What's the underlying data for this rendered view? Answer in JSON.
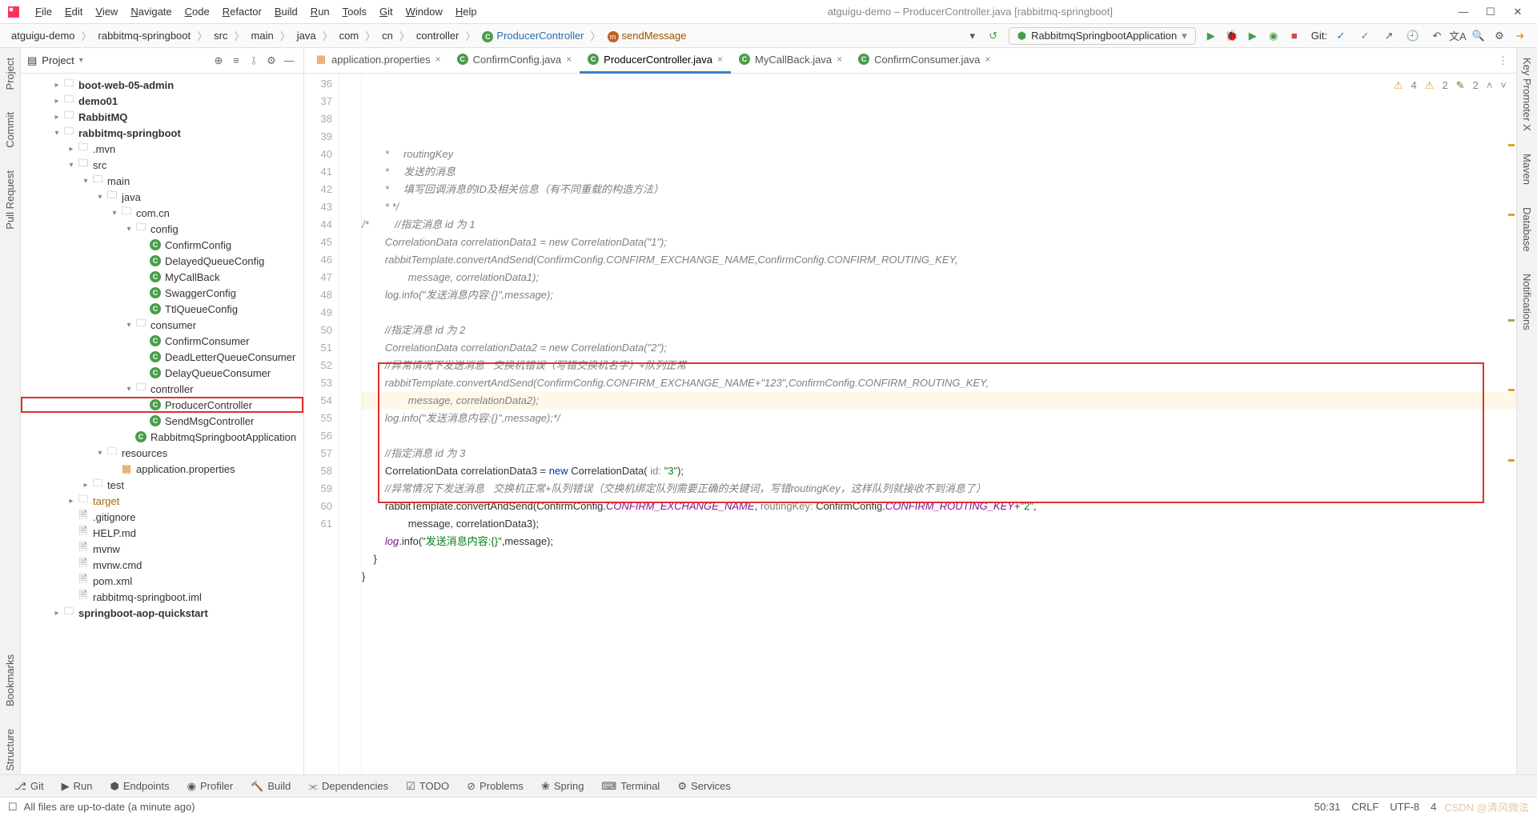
{
  "window": {
    "title": "atguigu-demo – ProducerController.java [rabbitmq-springboot]"
  },
  "menu": [
    "File",
    "Edit",
    "View",
    "Navigate",
    "Code",
    "Refactor",
    "Build",
    "Run",
    "Tools",
    "Git",
    "Window",
    "Help"
  ],
  "breadcrumbs": [
    {
      "label": "atguigu-demo",
      "kind": "plain"
    },
    {
      "label": "rabbitmq-springboot",
      "kind": "plain"
    },
    {
      "label": "src",
      "kind": "plain"
    },
    {
      "label": "main",
      "kind": "plain"
    },
    {
      "label": "java",
      "kind": "plain"
    },
    {
      "label": "com",
      "kind": "plain"
    },
    {
      "label": "cn",
      "kind": "plain"
    },
    {
      "label": "controller",
      "kind": "plain"
    },
    {
      "label": "ProducerController",
      "kind": "class"
    },
    {
      "label": "sendMessage",
      "kind": "method"
    }
  ],
  "runConfig": "RabbitmqSpringbootApplication",
  "gitLabel": "Git:",
  "projectPanel": {
    "title": "Project"
  },
  "tree": [
    {
      "indent": 1,
      "arrow": "▸",
      "icon": "folder",
      "label": "boot-web-05-admin",
      "bold": true
    },
    {
      "indent": 1,
      "arrow": "▸",
      "icon": "folder",
      "label": "demo01",
      "bold": true
    },
    {
      "indent": 1,
      "arrow": "▸",
      "icon": "folder",
      "label": "RabbitMQ",
      "bold": true
    },
    {
      "indent": 1,
      "arrow": "▾",
      "icon": "folder",
      "label": "rabbitmq-springboot",
      "bold": true
    },
    {
      "indent": 2,
      "arrow": "▸",
      "icon": "folder",
      "label": ".mvn"
    },
    {
      "indent": 2,
      "arrow": "▾",
      "icon": "folder-blue",
      "label": "src"
    },
    {
      "indent": 3,
      "arrow": "▾",
      "icon": "folder-blue",
      "label": "main"
    },
    {
      "indent": 4,
      "arrow": "▾",
      "icon": "folder-blue",
      "label": "java"
    },
    {
      "indent": 5,
      "arrow": "▾",
      "icon": "folder",
      "label": "com.cn"
    },
    {
      "indent": 6,
      "arrow": "▾",
      "icon": "folder",
      "label": "config"
    },
    {
      "indent": 7,
      "arrow": "",
      "icon": "class",
      "label": "ConfirmConfig"
    },
    {
      "indent": 7,
      "arrow": "",
      "icon": "class",
      "label": "DelayedQueueConfig"
    },
    {
      "indent": 7,
      "arrow": "",
      "icon": "class",
      "label": "MyCallBack"
    },
    {
      "indent": 7,
      "arrow": "",
      "icon": "class",
      "label": "SwaggerConfig"
    },
    {
      "indent": 7,
      "arrow": "",
      "icon": "class",
      "label": "TtlQueueConfig"
    },
    {
      "indent": 6,
      "arrow": "▾",
      "icon": "folder",
      "label": "consumer"
    },
    {
      "indent": 7,
      "arrow": "",
      "icon": "class",
      "label": "ConfirmConsumer"
    },
    {
      "indent": 7,
      "arrow": "",
      "icon": "class",
      "label": "DeadLetterQueueConsumer"
    },
    {
      "indent": 7,
      "arrow": "",
      "icon": "class",
      "label": "DelayQueueConsumer"
    },
    {
      "indent": 6,
      "arrow": "▾",
      "icon": "folder",
      "label": "controller"
    },
    {
      "indent": 7,
      "arrow": "",
      "icon": "class",
      "label": "ProducerController",
      "selected": true
    },
    {
      "indent": 7,
      "arrow": "",
      "icon": "class",
      "label": "SendMsgController"
    },
    {
      "indent": 6,
      "arrow": "",
      "icon": "class",
      "label": "RabbitmqSpringbootApplication"
    },
    {
      "indent": 4,
      "arrow": "▾",
      "icon": "folder-orange",
      "label": "resources"
    },
    {
      "indent": 5,
      "arrow": "",
      "icon": "prop",
      "label": "application.properties"
    },
    {
      "indent": 3,
      "arrow": "▸",
      "icon": "folder",
      "label": "test"
    },
    {
      "indent": 2,
      "arrow": "▸",
      "icon": "folder-orange",
      "label": "target",
      "orange": true
    },
    {
      "indent": 2,
      "arrow": "",
      "icon": "file",
      "label": ".gitignore"
    },
    {
      "indent": 2,
      "arrow": "",
      "icon": "file",
      "label": "HELP.md"
    },
    {
      "indent": 2,
      "arrow": "",
      "icon": "file",
      "label": "mvnw"
    },
    {
      "indent": 2,
      "arrow": "",
      "icon": "file",
      "label": "mvnw.cmd"
    },
    {
      "indent": 2,
      "arrow": "",
      "icon": "file",
      "label": "pom.xml"
    },
    {
      "indent": 2,
      "arrow": "",
      "icon": "file",
      "label": "rabbitmq-springboot.iml"
    },
    {
      "indent": 1,
      "arrow": "▸",
      "icon": "folder",
      "label": "springboot-aop-quickstart",
      "bold": true
    }
  ],
  "tabs": [
    {
      "icon": "prop",
      "label": "application.properties",
      "active": false
    },
    {
      "icon": "class",
      "label": "ConfirmConfig.java",
      "active": false
    },
    {
      "icon": "class",
      "label": "ProducerController.java",
      "active": true
    },
    {
      "icon": "class",
      "label": "MyCallBack.java",
      "active": false
    },
    {
      "icon": "class",
      "label": "ConfirmConsumer.java",
      "active": false
    }
  ],
  "inspection": {
    "warn1": "4",
    "warn2": "2",
    "up": "2"
  },
  "gutter": {
    "start": 36,
    "end": 61
  },
  "code": [
    {
      "n": 36,
      "html": "        <span class='cm-comment'>*     routingKey</span>"
    },
    {
      "n": 37,
      "html": "        <span class='cm-comment'>*     发送的消息</span>"
    },
    {
      "n": 38,
      "html": "        <span class='cm-comment'>*     填写回调消息的ID及相关信息（有不同重载的构造方法）</span>"
    },
    {
      "n": 39,
      "html": "        <span class='cm-comment'>* */</span>"
    },
    {
      "n": 40,
      "html": "<span class='cm-comment'>/*</span>         <span class='cm-comment'>//指定消息 id 为 1</span>"
    },
    {
      "n": 41,
      "html": "        <span class='cm-comment'>CorrelationData correlationData1 = new CorrelationData(\"1\");</span>"
    },
    {
      "n": 42,
      "html": "        <span class='cm-comment'>rabbitTemplate.convertAndSend(ConfirmConfig.CONFIRM_EXCHANGE_NAME,ConfirmConfig.CONFIRM_ROUTING_KEY,</span>"
    },
    {
      "n": 43,
      "html": "                <span class='cm-comment'>message, correlationData1);</span>"
    },
    {
      "n": 44,
      "html": "        <span class='cm-comment'>log.info(\"发送消息内容:{}\",message);</span>"
    },
    {
      "n": 45,
      "html": ""
    },
    {
      "n": 46,
      "html": "        <span class='cm-comment'>//指定消息 id 为 2</span>"
    },
    {
      "n": 47,
      "html": "        <span class='cm-comment'>CorrelationData correlationData2 = new CorrelationData(\"2\");</span>"
    },
    {
      "n": 48,
      "html": "        <span class='cm-comment'>//异常情况下发送消息   交换机错误（写错交换机名字）+队列正常</span>"
    },
    {
      "n": 49,
      "html": "        <span class='cm-comment'>rabbitTemplate.convertAndSend(ConfirmConfig.CONFIRM_EXCHANGE_NAME+\"123\",ConfirmConfig.CONFIRM_ROUTING_KEY,</span>"
    },
    {
      "n": 50,
      "html": "                <span class='cm-comment'>message, correlationData2);</span>",
      "hl": true
    },
    {
      "n": 51,
      "html": "        <span class='cm-comment'>log.info(\"发送消息内容:{}\",message);*/</span>"
    },
    {
      "n": 52,
      "html": ""
    },
    {
      "n": 53,
      "html": "        <span class='cm-comment'>//指定消息 id 为 3</span>"
    },
    {
      "n": 54,
      "html": "        CorrelationData correlationData3 = <span class='cm-keyword'>new</span> CorrelationData( <span class='cm-param'>id:</span> <span class='cm-string'>\"3\"</span>);"
    },
    {
      "n": 55,
      "html": "        <span class='cm-comment'>//异常情况下发送消息   交换机正常+队列错误（交换机绑定队列需要正确的关键词，写错routingKey，这样队列就接收不到消息了）</span>"
    },
    {
      "n": 56,
      "html": "        rabbitTemplate.convertAndSend(ConfirmConfig.<span class='cm-field'>CONFIRM_EXCHANGE_NAME</span>, <span class='cm-param'>routingKey:</span> ConfirmConfig.<span class='cm-field'>CONFIRM_ROUTING_KEY</span>+<span class='cm-string'>\"2\"</span>,"
    },
    {
      "n": 57,
      "html": "                message, correlationData3);"
    },
    {
      "n": 58,
      "html": "        <span class='cm-field'>log</span>.info(<span class='cm-string'>\"发送消息内容:{}\"</span>,message);"
    },
    {
      "n": 59,
      "html": "    }"
    },
    {
      "n": 60,
      "html": "}"
    },
    {
      "n": 61,
      "html": ""
    }
  ],
  "bottomTools": [
    "Git",
    "Run",
    "Endpoints",
    "Profiler",
    "Build",
    "Dependencies",
    "TODO",
    "Problems",
    "Spring",
    "Terminal",
    "Services"
  ],
  "status": {
    "message": "All files are up-to-date (a minute ago)",
    "pos": "50:31",
    "linesep": "CRLF",
    "encoding": "UTF-8",
    "indent": "4",
    "watermark": "CSDN @清风微泫"
  },
  "leftStrip": [
    "Project",
    "Commit",
    "Pull Request"
  ],
  "leftStripBottom": [
    "Bookmarks",
    "Structure"
  ],
  "rightStrip": [
    "Key Promoter X",
    "Maven",
    "Database",
    "Notifications"
  ]
}
